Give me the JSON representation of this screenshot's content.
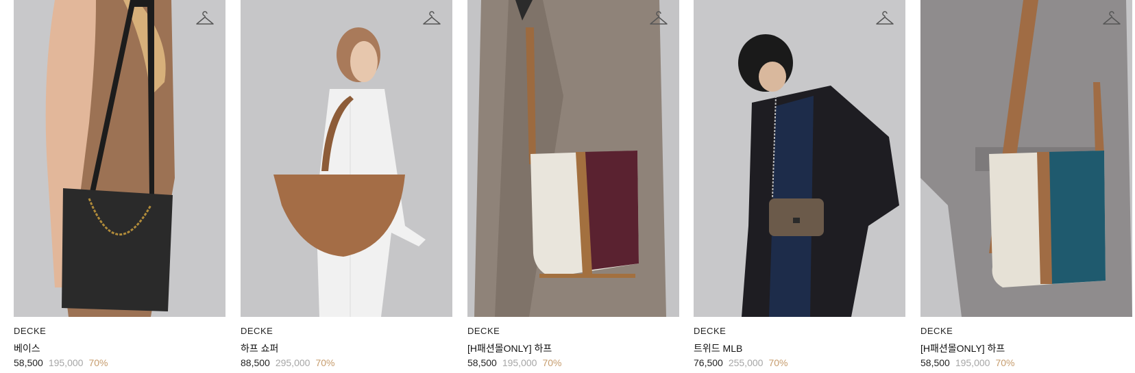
{
  "colors": {
    "discount": "#c69c6d",
    "original_price": "#a6a6a6",
    "photo_background": "#c9c9cb"
  },
  "products": [
    {
      "brand": "DECKE",
      "name": "베이스",
      "price": "58,500",
      "original_price": "195,000",
      "discount": "70%",
      "icon": "hanger-icon",
      "bag_color": "#262626"
    },
    {
      "brand": "DECKE",
      "name": "하프 쇼퍼",
      "price": "88,500",
      "original_price": "295,000",
      "discount": "70%",
      "icon": "hanger-icon",
      "bag_color": "#a06c44"
    },
    {
      "brand": "DECKE",
      "name": "[H패션몰ONLY] 하프",
      "price": "58,500",
      "original_price": "195,000",
      "discount": "70%",
      "icon": "hanger-icon",
      "bag_color": "#5a2230"
    },
    {
      "brand": "DECKE",
      "name": "트위드 MLB",
      "price": "76,500",
      "original_price": "255,000",
      "discount": "70%",
      "icon": "hanger-icon",
      "bag_color": "#6b5a4a"
    },
    {
      "brand": "DECKE",
      "name": "[H패션몰ONLY] 하프",
      "price": "58,500",
      "original_price": "195,000",
      "discount": "70%",
      "icon": "hanger-icon",
      "bag_color": "#1f5a6e"
    }
  ]
}
